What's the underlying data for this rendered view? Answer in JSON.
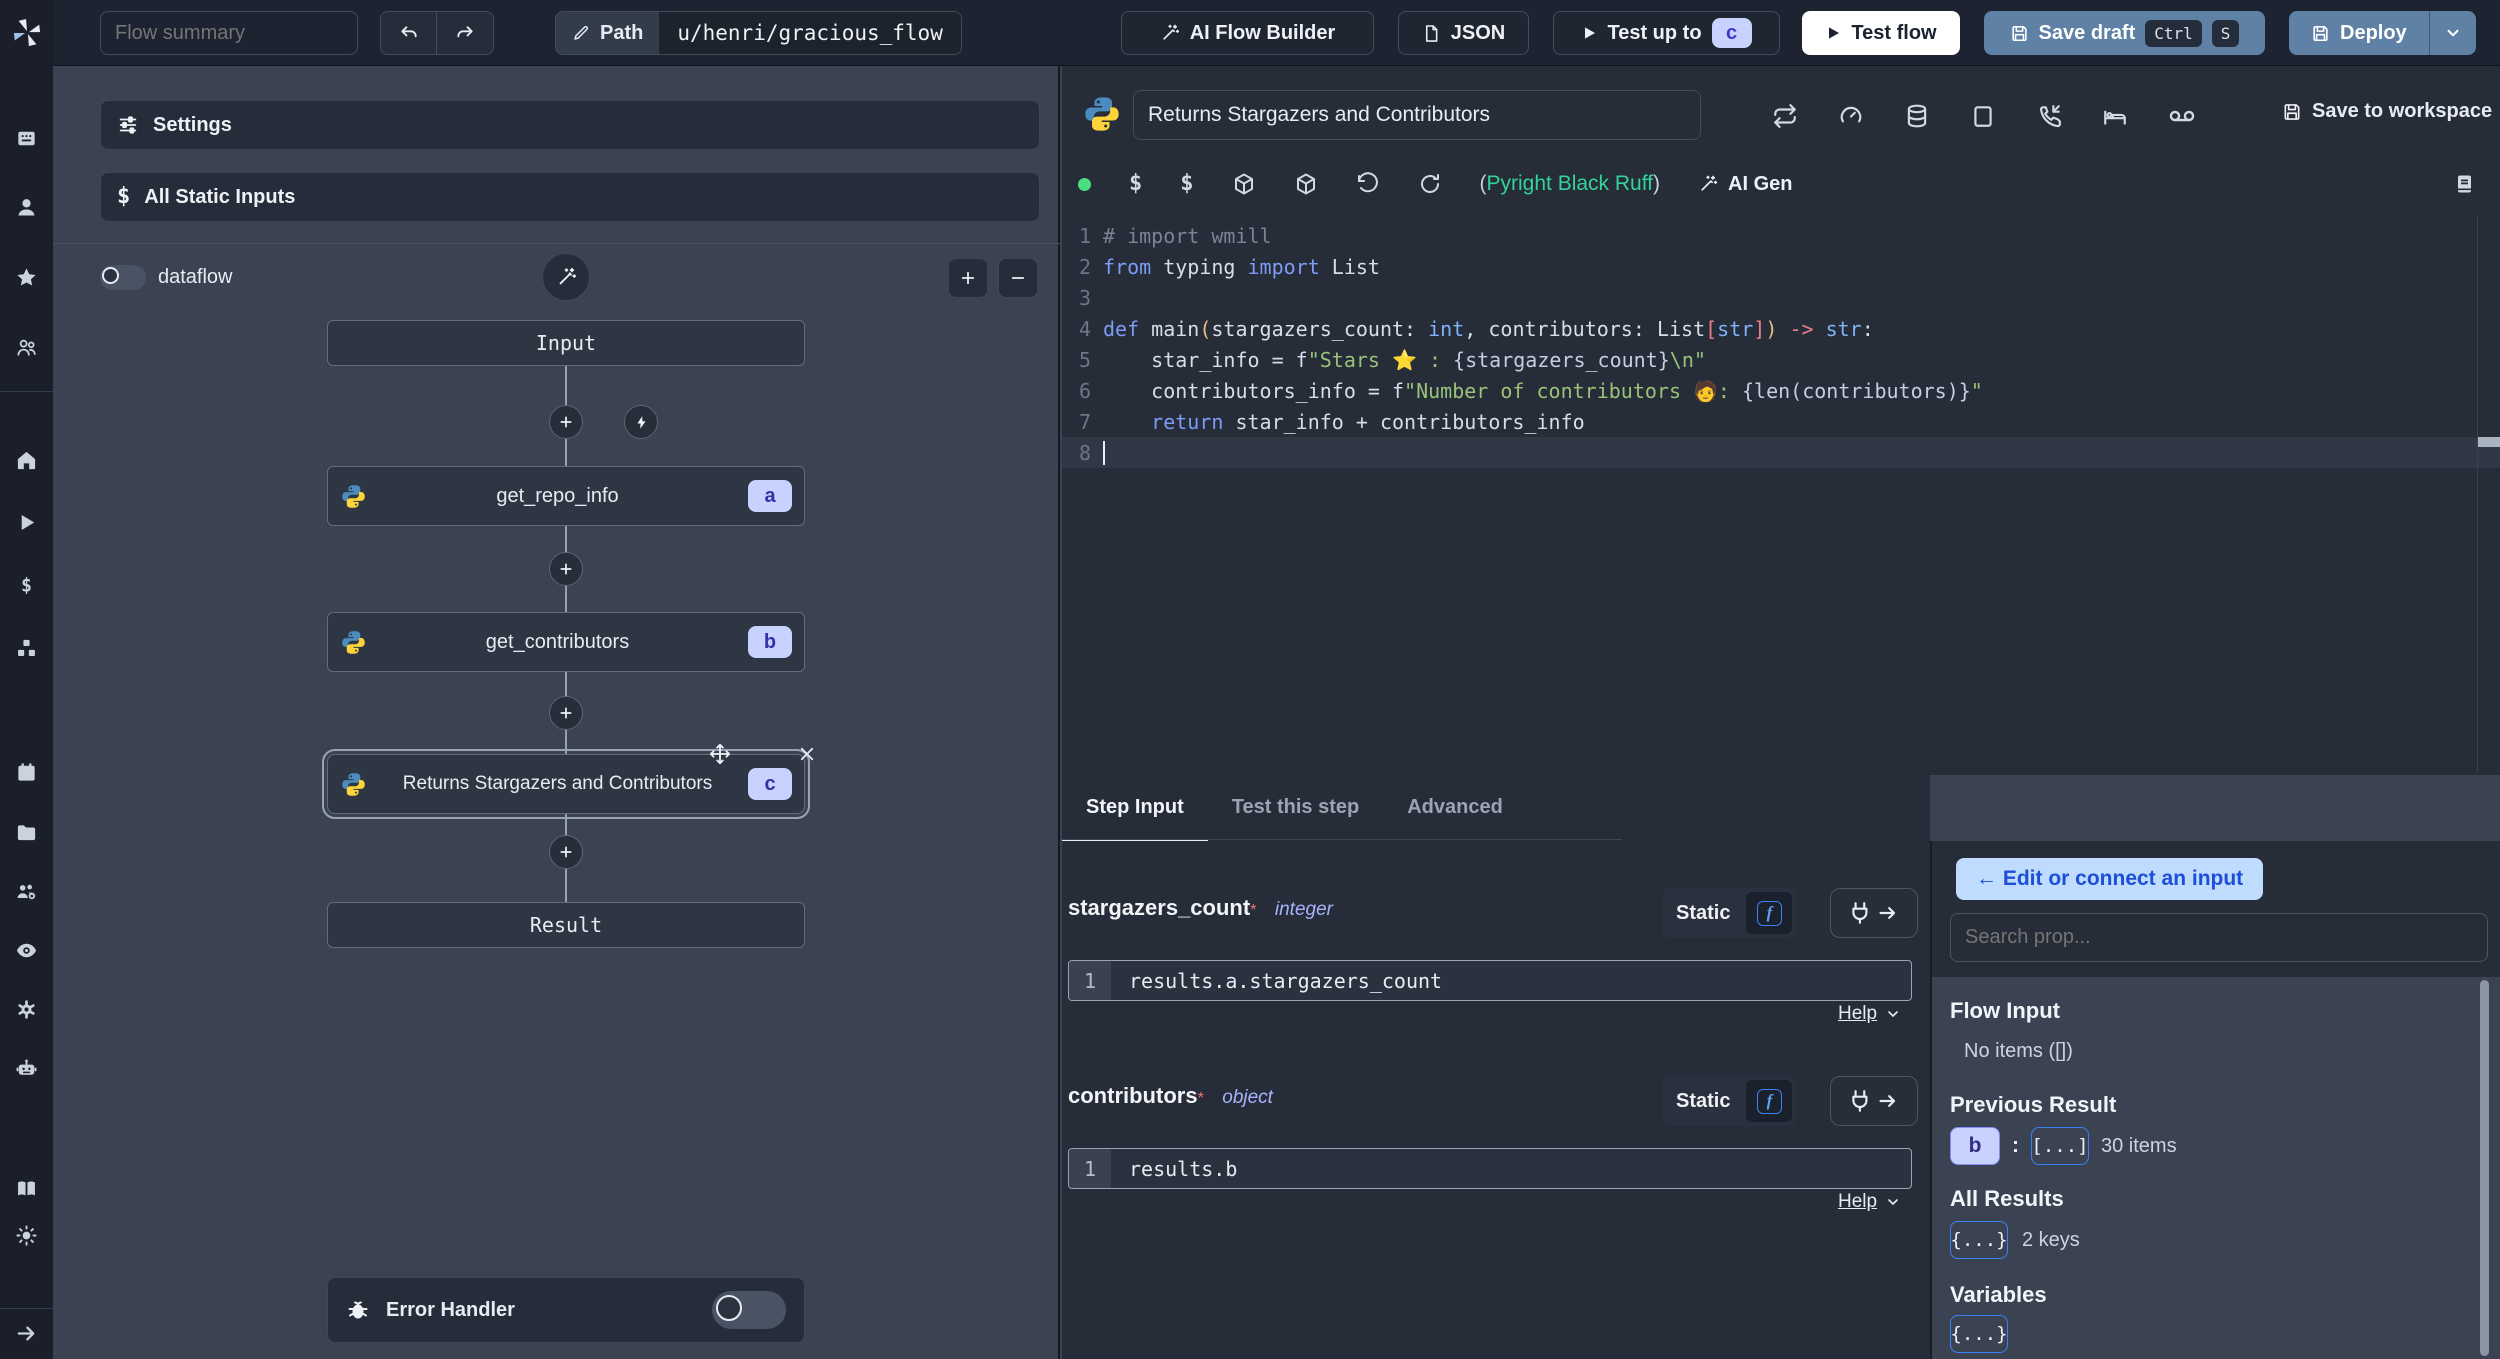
{
  "topbar": {
    "flow_summary_placeholder": "Flow summary",
    "path": {
      "label": "Path",
      "value": "u/henri/gracious_flow"
    },
    "ai_flow_builder_label": "AI Flow Builder",
    "json_label": "JSON",
    "test_up_to_label": "Test up to",
    "test_up_to_badge": "c",
    "test_flow_label": "Test flow",
    "save_draft_label": "Save draft",
    "shortcut_ctrl": "Ctrl",
    "shortcut_s": "S",
    "deploy_label": "Deploy"
  },
  "sidebar": {
    "items": [
      "workspace",
      "user",
      "favorites",
      "groups",
      "home",
      "runs",
      "variables",
      "resources",
      "schedules",
      "folders",
      "workers",
      "audit-logs",
      "settings",
      "ai",
      "docs",
      "theme-toggle",
      "expand-sidebar"
    ]
  },
  "flow_panel": {
    "settings_label": "Settings",
    "static_inputs_label": "All Static Inputs",
    "dataflow_label": "dataflow",
    "input_node": "Input",
    "result_node": "Result",
    "steps": [
      {
        "name": "get_repo_info",
        "badge": "a"
      },
      {
        "name": "get_contributors",
        "badge": "b"
      },
      {
        "name": "Returns Stargazers and Contributors",
        "badge": "c"
      }
    ],
    "error_handler_label": "Error Handler"
  },
  "editor": {
    "title": "Returns Stargazers and Contributors",
    "save_to_workspace_label": "Save to workspace",
    "lint_open": "(",
    "lint_label": "Pyright Black Ruff",
    "lint_close": ")",
    "ai_gen_label": "AI Gen",
    "code": {
      "current_line": 8,
      "lines": [
        [
          [
            "cm",
            "# import wmill"
          ]
        ],
        [
          [
            "kw",
            "from"
          ],
          [
            "id",
            " typing "
          ],
          [
            "kw",
            "import"
          ],
          [
            "id",
            " List"
          ]
        ],
        [],
        [
          [
            "kw",
            "def"
          ],
          [
            "id",
            " main"
          ],
          [
            "pa",
            "("
          ],
          [
            "id",
            "stargazers_count"
          ],
          [
            "op",
            ": "
          ],
          [
            "ty",
            "int"
          ],
          [
            "op",
            ", "
          ],
          [
            "id",
            "contributors"
          ],
          [
            "op",
            ": "
          ],
          [
            "id",
            "List"
          ],
          [
            "br",
            "["
          ],
          [
            "ty",
            "str"
          ],
          [
            "br",
            "]"
          ],
          [
            "pa",
            ")"
          ],
          [
            "op",
            " "
          ],
          [
            "br",
            "->"
          ],
          [
            "op",
            " "
          ],
          [
            "ty",
            "str"
          ],
          [
            "op",
            ":"
          ]
        ],
        [
          [
            "id",
            "    star_info "
          ],
          [
            "op",
            "= "
          ],
          [
            "id",
            "f"
          ],
          [
            "st",
            "\"Stars ⭐ : "
          ],
          [
            "in",
            "{stargazers_count}"
          ],
          [
            "st",
            "\\n\""
          ]
        ],
        [
          [
            "id",
            "    contributors_info "
          ],
          [
            "op",
            "= "
          ],
          [
            "id",
            "f"
          ],
          [
            "st",
            "\"Number of contributors 🧑: "
          ],
          [
            "in",
            "{len(contributors)}"
          ],
          [
            "st",
            "\""
          ]
        ],
        [
          [
            "kw",
            "    return"
          ],
          [
            "id",
            " star_info "
          ],
          [
            "op",
            "+ "
          ],
          [
            "id",
            "contributors_info"
          ]
        ],
        []
      ]
    }
  },
  "tabs": {
    "items": [
      "Step Input",
      "Test this step",
      "Advanced"
    ],
    "active": "Step Input"
  },
  "step_input": {
    "fields": [
      {
        "name": "stargazers_count",
        "required": "*",
        "type": "integer",
        "mode_label": "Static",
        "function_glyph": "f",
        "line_no": "1",
        "expression": "results.a.stargazers_count",
        "help_label": "Help"
      },
      {
        "name": "contributors",
        "required": "*",
        "type": "object",
        "mode_label": "Static",
        "function_glyph": "f",
        "line_no": "1",
        "expression": "results.b",
        "help_label": "Help"
      }
    ]
  },
  "props_panel": {
    "edit_button_label": "← Edit or connect an input",
    "search_placeholder": "Search prop...",
    "flow_input_title": "Flow Input",
    "flow_input_empty": "No items ([])",
    "previous_result_title": "Previous Result",
    "previous_result_badge": "b",
    "previous_result_colon": ":",
    "previous_result_collapsed": "[...]",
    "previous_result_count": "30 items",
    "all_results_title": "All Results",
    "all_results_collapsed": "{...}",
    "all_results_count": "2 keys",
    "variables_title": "Variables",
    "variables_collapsed": "{...}"
  },
  "colors": {
    "accent_blue": "#3b82f6",
    "indigo_badge_bg": "#c7d2fe",
    "indigo_badge_text": "#3730a3",
    "slate_button": "#5f81a5",
    "light_blue_pill_bg": "#bfdbfe",
    "light_blue_pill_text": "#1d4ed8",
    "success_green": "#34d399"
  }
}
